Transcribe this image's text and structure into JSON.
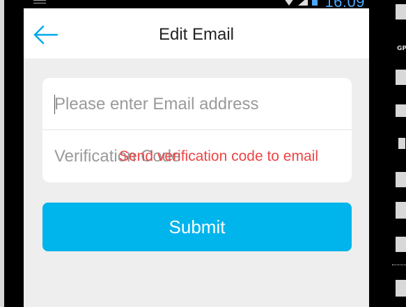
{
  "status_bar": {
    "time": "16:09"
  },
  "header": {
    "title": "Edit Email",
    "back_icon": "arrow-left-icon"
  },
  "form": {
    "email_placeholder": "Please enter Email address",
    "code_placeholder": "Verification Code",
    "send_code_label": "Send verification code to email"
  },
  "submit_label": "Submit",
  "colors": {
    "accent": "#00b4ec",
    "link_red": "#ef4444",
    "back_arrow": "#00a8e8",
    "background": "#eeeeee"
  },
  "right_nav": {
    "gps_label": "GPS"
  }
}
